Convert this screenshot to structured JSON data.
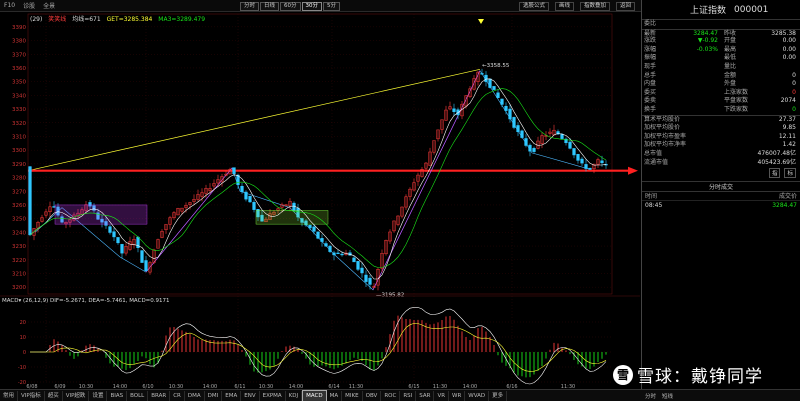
{
  "topbar": {
    "items": [
      "F10",
      "诊股",
      "全景"
    ],
    "periods": [
      "分时",
      "日线",
      "60分",
      "30分",
      "5分"
    ],
    "active_period": "30分",
    "right_items": [
      "选股公式",
      "画线",
      "指数叠加",
      "返回"
    ]
  },
  "legend": {
    "prefix": "(29)",
    "items": [
      {
        "text": "笑笑线",
        "color": "#ff3b3b"
      },
      {
        "text": "均线=671",
        "color": "#ffffff"
      },
      {
        "text": "GET=3285.384",
        "color": "#ffff33"
      },
      {
        "text": "MA3=3289.479",
        "color": "#19e619"
      }
    ]
  },
  "chart_data": {
    "type": "candlestick",
    "y_axis": {
      "ticks": [
        3200,
        3210,
        3220,
        3230,
        3240,
        3250,
        3260,
        3270,
        3280,
        3290,
        3300,
        3310,
        3320,
        3330,
        3340,
        3350,
        3360,
        3370,
        3380,
        3390
      ],
      "range": [
        3195,
        3395
      ]
    },
    "x_ticks": [
      "6/08",
      "6/09",
      "10:30",
      "14:00",
      "6/10",
      "10:30",
      "14:00",
      "6/11",
      "10:30",
      "14:00",
      "6/14",
      "11:30",
      "6/15",
      "11:30",
      "14:00",
      "6/16",
      "11:30"
    ],
    "annotations": [
      {
        "text": "3358.55",
        "series": "high"
      },
      {
        "text": "3195.82",
        "series": "low"
      }
    ],
    "horizontal_line_value": 3285,
    "macd": {
      "label": "MACD",
      "params": "(26,12,9)",
      "dif": "DIF=-5.2671",
      "dea": "DEA=-5.7461",
      "macd": "MACD=0.9171",
      "ticks": [
        -20,
        -10,
        0,
        10,
        20
      ]
    },
    "colors": {
      "up": "#ff3b3b",
      "down": "#2ec7ff",
      "ma_short": "#ffffff",
      "ma_long": "#19e619",
      "trend": "#ffff33",
      "resistance": "#ff2020"
    }
  },
  "right_panel": {
    "index_name": "上证指数",
    "index_code": "000001",
    "rows": [
      {
        "l": "委比",
        "v": "",
        "l2": "",
        "v2": ""
      },
      {
        "l": "最新",
        "v": "3284.47",
        "vc": "green",
        "l2": "昨收",
        "v2": "3285.38",
        "v2c": "white"
      },
      {
        "l": "涨跌",
        "v": "▼-0.92",
        "vc": "green",
        "l2": "开盘",
        "v2": "0.00",
        "v2c": "white"
      },
      {
        "l": "涨幅",
        "v": "-0.03%",
        "vc": "green",
        "l2": "最高",
        "v2": "0.00",
        "v2c": "white"
      },
      {
        "l": "振幅",
        "v": "",
        "vc": "white",
        "l2": "最低",
        "v2": "0.00",
        "v2c": "white"
      },
      {
        "l": "现手",
        "v": "",
        "vc": "white",
        "l2": "量比",
        "v2": "",
        "v2c": "white"
      },
      {
        "l": "总手",
        "v": "",
        "vc": "white",
        "l2": "金额",
        "v2": "0",
        "v2c": "white"
      },
      {
        "l": "内盘",
        "v": "",
        "vc": "white",
        "l2": "外盘",
        "v2": "0",
        "v2c": "white"
      },
      {
        "l": "委买",
        "v": "",
        "vc": "white",
        "l2": "上涨家数",
        "v2": "0",
        "v2c": "red"
      },
      {
        "l": "委卖",
        "v": "",
        "vc": "white",
        "l2": "平盘家数",
        "v2": "2074",
        "v2c": "white"
      },
      {
        "l": "换手",
        "v": "",
        "vc": "white",
        "l2": "下跌家数",
        "v2": "0",
        "v2c": "green"
      }
    ],
    "single_rows": [
      {
        "l": "算术平均股价",
        "v": "27.37"
      },
      {
        "l": "加权平均股价",
        "v": "9.85"
      },
      {
        "l": "加权平均市盈率",
        "v": "12.11"
      },
      {
        "l": "加权平均市净率",
        "v": "1.42"
      },
      {
        "l": "总市值",
        "v": "476007.48亿"
      },
      {
        "l": "流通市值",
        "v": "405423.69亿"
      }
    ],
    "buttons": [
      "指",
      "标"
    ],
    "tick_header": "分时成交",
    "tick_cols": [
      "时间",
      "成交价"
    ],
    "tick_row": {
      "time": "08:45",
      "price": "3284.47"
    }
  },
  "bottombar": {
    "items": [
      "常用",
      "VIP指标",
      "超买",
      "VIP超跌",
      "设置",
      "BIAS",
      "BOLL",
      "BRAR",
      "CR",
      "DMA",
      "DMI",
      "EMA",
      "ENV",
      "EXPMA",
      "KDJ",
      "MACD",
      "MA",
      "MIKE",
      "OBV",
      "ROC",
      "RSI",
      "SAR",
      "VR",
      "WR",
      "WVAD",
      "更多"
    ],
    "active": "MACD"
  },
  "rp_bottom": {
    "items": [
      "分时",
      "短线"
    ]
  },
  "watermark": {
    "logo": "雪",
    "text": "雪球：戴铮同学"
  }
}
